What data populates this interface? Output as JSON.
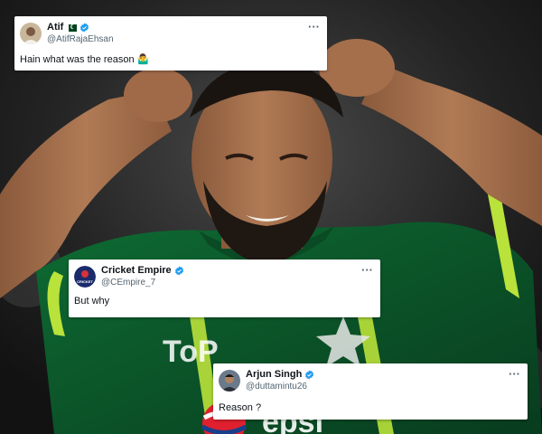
{
  "tweets": [
    {
      "name": "Atif",
      "handle": "@AtifRajaEhsan",
      "text": "Hain what was the reason",
      "emoji": "🤷‍♂️",
      "verified": true,
      "flag_icon": "pakistan-flag-icon"
    },
    {
      "name": "Cricket Empire",
      "handle": "@CEmpire_7",
      "text": "But why",
      "avatar_label": "CRICKET",
      "verified": true
    },
    {
      "name": "Arjun Singh",
      "handle": "@duttamintu26",
      "text": "Reason ?",
      "verified": true
    }
  ],
  "more_label": "···",
  "colors": {
    "verified_blue": "#1d9bf0",
    "jersey_green": "#0d5a2c",
    "jersey_lime": "#b9e23b",
    "handle_gray": "#536471"
  }
}
